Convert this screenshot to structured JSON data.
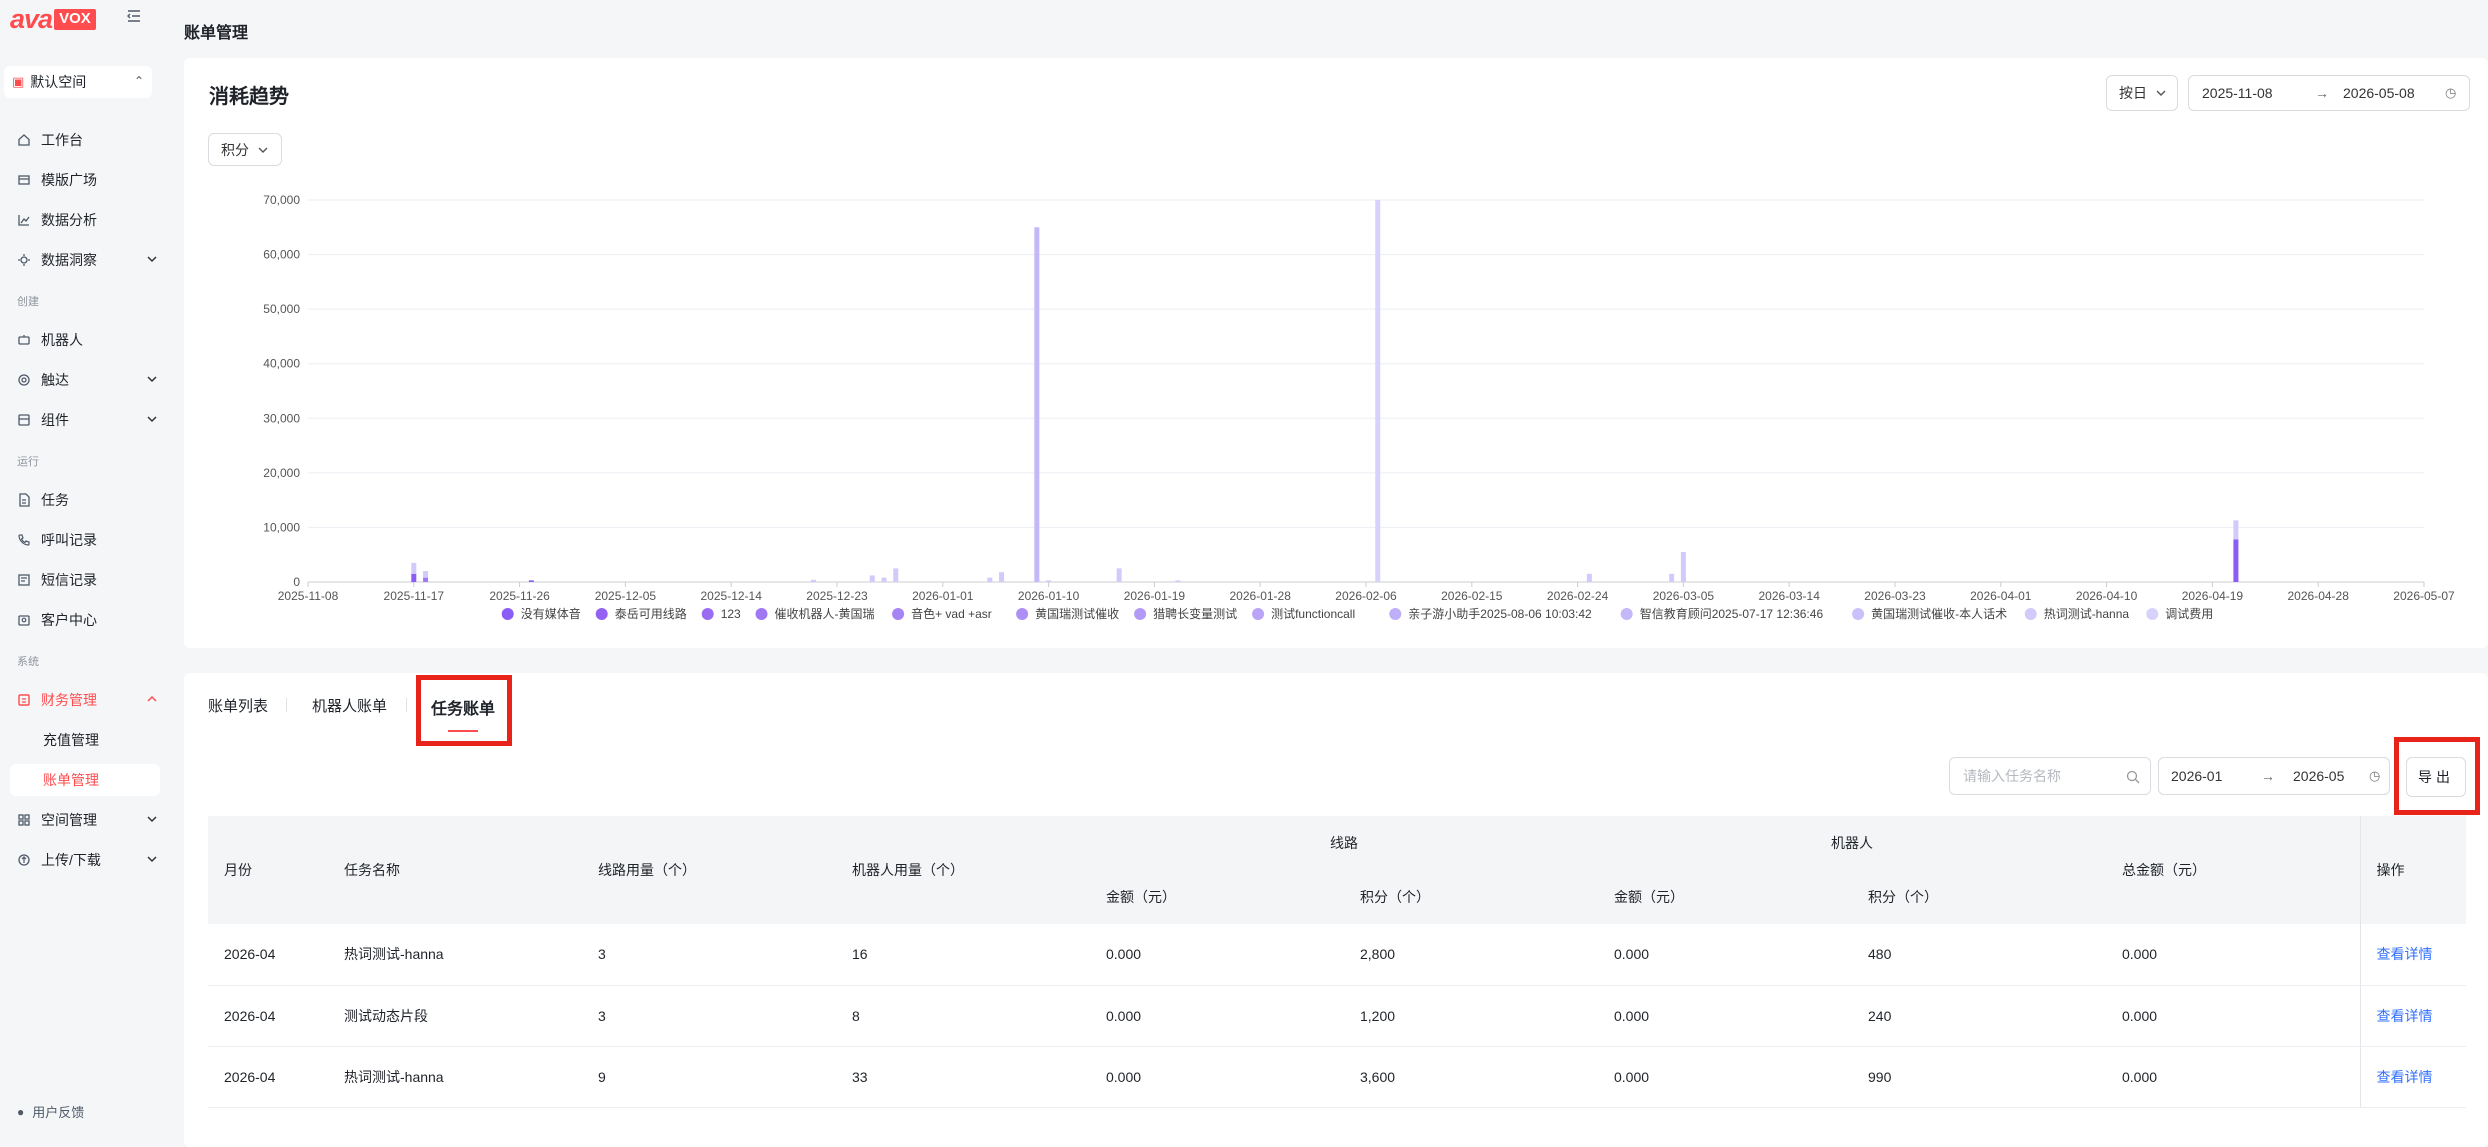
{
  "app": {
    "logo_primary": "ava",
    "logo_secondary": "VOX",
    "brand_color": "#ff4d4f"
  },
  "workspace": {
    "label": "默认空间"
  },
  "sidebar": {
    "items": [
      {
        "label": "工作台",
        "icon": "home-icon"
      },
      {
        "label": "模版广场",
        "icon": "template-icon"
      },
      {
        "label": "数据分析",
        "icon": "chart-icon"
      },
      {
        "label": "数据洞察",
        "icon": "insight-icon",
        "expandable": true
      }
    ],
    "sections": {
      "create": "创建",
      "run": "运行",
      "system": "系统"
    },
    "create_items": [
      {
        "label": "机器人",
        "icon": "robot-icon"
      },
      {
        "label": "触达",
        "icon": "reach-icon",
        "expandable": true
      },
      {
        "label": "组件",
        "icon": "component-icon",
        "expandable": true
      }
    ],
    "run_items": [
      {
        "label": "任务",
        "icon": "task-icon"
      },
      {
        "label": "呼叫记录",
        "icon": "phone-icon"
      },
      {
        "label": "短信记录",
        "icon": "sms-icon"
      },
      {
        "label": "客户中心",
        "icon": "customer-icon"
      }
    ],
    "system_items": [
      {
        "label": "财务管理",
        "icon": "finance-icon",
        "expanded": true
      },
      {
        "label": "空间管理",
        "icon": "space-icon",
        "expandable": true
      },
      {
        "label": "上传/下载",
        "icon": "upload-icon",
        "expandable": true
      }
    ],
    "finance_sub": [
      "充值管理",
      "账单管理"
    ],
    "feedback": "用户反馈"
  },
  "page": {
    "title": "账单管理"
  },
  "trend": {
    "title": "消耗趋势",
    "granularity": "按日",
    "start_date": "2025-11-08",
    "end_date": "2026-05-08",
    "metric": "积分"
  },
  "chart_data": {
    "type": "bar",
    "ylim": [
      0,
      70000
    ],
    "yticks": [
      "0",
      "10,000",
      "20,000",
      "30,000",
      "40,000",
      "50,000",
      "60,000",
      "70,000"
    ],
    "xticks": [
      "2025-11-08",
      "2025-11-17",
      "2025-11-26",
      "2025-12-05",
      "2025-12-14",
      "2025-12-23",
      "2026-01-01",
      "2026-01-10",
      "2026-01-19",
      "2026-01-28",
      "2026-02-06",
      "2026-02-15",
      "2026-02-24",
      "2026-03-05",
      "2026-03-14",
      "2026-03-23",
      "2026-04-01",
      "2026-04-10",
      "2026-04-19",
      "2026-04-28",
      "2026-05-07"
    ],
    "stacked": true,
    "legend_position": "bottom",
    "series": [
      {
        "name": "没有媒体音",
        "color": "#8b5cf6"
      },
      {
        "name": "泰岳可用线路",
        "color": "#9461f0"
      },
      {
        "name": "123",
        "color": "#9b6cf2"
      },
      {
        "name": "催收机器人-黄国瑞",
        "color": "#a178f3"
      },
      {
        "name": "音色+ vad +asr",
        "color": "#a784f4"
      },
      {
        "name": "黄国瑞测试催收",
        "color": "#ad8ff5"
      },
      {
        "name": "猎聘长变量测试",
        "color": "#b39af6"
      },
      {
        "name": "测试functioncall",
        "color": "#b9a4f7"
      },
      {
        "name": "亲子游小助手2025-08-06 10:03:42",
        "color": "#bfaef8"
      },
      {
        "name": "智信教育顾问2025-07-17 12:36:46",
        "color": "#c5b8f9"
      },
      {
        "name": "黄国瑞测试催收-本人话术",
        "color": "#cbc1fa"
      },
      {
        "name": "热词测试-hanna",
        "color": "#d1cafb"
      },
      {
        "name": "调试费用",
        "color": "#d7d2fc"
      }
    ],
    "bars": [
      {
        "x": "2025-11-17",
        "values": [
          {
            "s": 0,
            "v": 1500
          },
          {
            "s": 11,
            "v": 2000
          }
        ]
      },
      {
        "x": "2025-11-18",
        "values": [
          {
            "s": 3,
            "v": 800
          },
          {
            "s": 11,
            "v": 1200
          }
        ]
      },
      {
        "x": "2025-11-27",
        "values": [
          {
            "s": 0,
            "v": 300
          }
        ]
      },
      {
        "x": "2025-12-21",
        "values": [
          {
            "s": 11,
            "v": 400
          }
        ]
      },
      {
        "x": "2025-12-26",
        "values": [
          {
            "s": 11,
            "v": 1200
          }
        ]
      },
      {
        "x": "2025-12-27",
        "values": [
          {
            "s": 11,
            "v": 800
          }
        ]
      },
      {
        "x": "2025-12-28",
        "values": [
          {
            "s": 11,
            "v": 2500
          }
        ]
      },
      {
        "x": "2026-01-05",
        "values": [
          {
            "s": 11,
            "v": 800
          }
        ]
      },
      {
        "x": "2026-01-06",
        "values": [
          {
            "s": 11,
            "v": 1800
          }
        ]
      },
      {
        "x": "2026-01-09",
        "values": [
          {
            "s": 9,
            "v": 65000
          }
        ]
      },
      {
        "x": "2026-01-10",
        "values": [
          {
            "s": 11,
            "v": 300
          }
        ]
      },
      {
        "x": "2026-01-16",
        "values": [
          {
            "s": 11,
            "v": 2500
          }
        ]
      },
      {
        "x": "2026-01-21",
        "values": [
          {
            "s": 11,
            "v": 300
          }
        ]
      },
      {
        "x": "2026-02-07",
        "values": [
          {
            "s": 12,
            "v": 70000
          }
        ]
      },
      {
        "x": "2026-02-25",
        "values": [
          {
            "s": 11,
            "v": 1500
          }
        ]
      },
      {
        "x": "2026-03-04",
        "values": [
          {
            "s": 11,
            "v": 1500
          }
        ]
      },
      {
        "x": "2026-03-05",
        "values": [
          {
            "s": 11,
            "v": 5500
          }
        ]
      },
      {
        "x": "2026-04-21",
        "values": [
          {
            "s": 0,
            "v": 7800
          },
          {
            "s": 11,
            "v": 3500
          }
        ]
      }
    ]
  },
  "bill_tabs": [
    "账单列表",
    "机器人账单",
    "任务账单"
  ],
  "filters": {
    "search_placeholder": "请输入任务名称",
    "start_month": "2026-01",
    "end_month": "2026-05",
    "export_label": "导出"
  },
  "table": {
    "columns": {
      "month": "月份",
      "task_name": "任务名称",
      "line_usage": "线路用量（个）",
      "robot_usage": "机器人用量（个）",
      "line_group": "线路",
      "robot_group": "机器人",
      "amount": "金额（元）",
      "points": "积分（个）",
      "total": "总金额（元）",
      "action": "操作"
    },
    "rows": [
      {
        "month": "2026-04",
        "task_name": "热词测试-hanna",
        "line_usage": "3",
        "robot_usage": "16",
        "line_amount": "0.000",
        "line_points": "2,800",
        "robot_amount": "0.000",
        "robot_points": "480",
        "total": "0.000",
        "action": "查看详情"
      },
      {
        "month": "2026-04",
        "task_name": "测试动态片段",
        "line_usage": "3",
        "robot_usage": "8",
        "line_amount": "0.000",
        "line_points": "1,200",
        "robot_amount": "0.000",
        "robot_points": "240",
        "total": "0.000",
        "action": "查看详情"
      },
      {
        "month": "2026-04",
        "task_name": "热词测试-hanna",
        "line_usage": "9",
        "robot_usage": "33",
        "line_amount": "0.000",
        "line_points": "3,600",
        "robot_amount": "0.000",
        "robot_points": "990",
        "total": "0.000",
        "action": "查看详情"
      }
    ]
  }
}
